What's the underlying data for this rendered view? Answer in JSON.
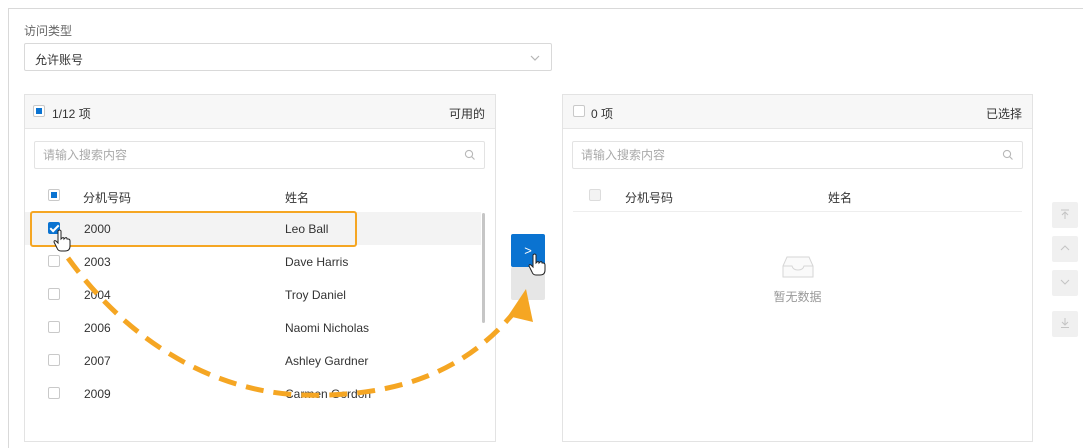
{
  "form": {
    "access_type_label": "访问类型",
    "access_type_value": "允许账号"
  },
  "left_panel": {
    "count_text": "1/12 项",
    "title": "可用的",
    "search_placeholder": "请输入搜索内容",
    "columns": {
      "ext": "分机号码",
      "name": "姓名"
    },
    "rows": [
      {
        "ext": "2000",
        "name": "Leo Ball",
        "checked": true
      },
      {
        "ext": "2003",
        "name": "Dave Harris",
        "checked": false
      },
      {
        "ext": "2004",
        "name": "Troy Daniel",
        "checked": false
      },
      {
        "ext": "2006",
        "name": "Naomi Nicholas",
        "checked": false
      },
      {
        "ext": "2007",
        "name": "Ashley Gardner",
        "checked": false
      },
      {
        "ext": "2009",
        "name": "Carmen Gordon",
        "checked": false
      }
    ]
  },
  "right_panel": {
    "count_text": "0 项",
    "title": "已选择",
    "search_placeholder": "请输入搜索内容",
    "columns": {
      "ext": "分机号码",
      "name": "姓名"
    },
    "empty_text": "暂无数据"
  },
  "transfer": {
    "move_right_glyph": ">"
  },
  "colors": {
    "primary": "#0a73d1",
    "annotation": "#f5a623"
  },
  "icons": {
    "chevron": "chevron-down-icon",
    "search": "search-icon",
    "empty": "inbox-icon",
    "side": [
      "move-top-icon",
      "move-up-icon",
      "move-down-icon",
      "move-bottom-icon"
    ]
  }
}
